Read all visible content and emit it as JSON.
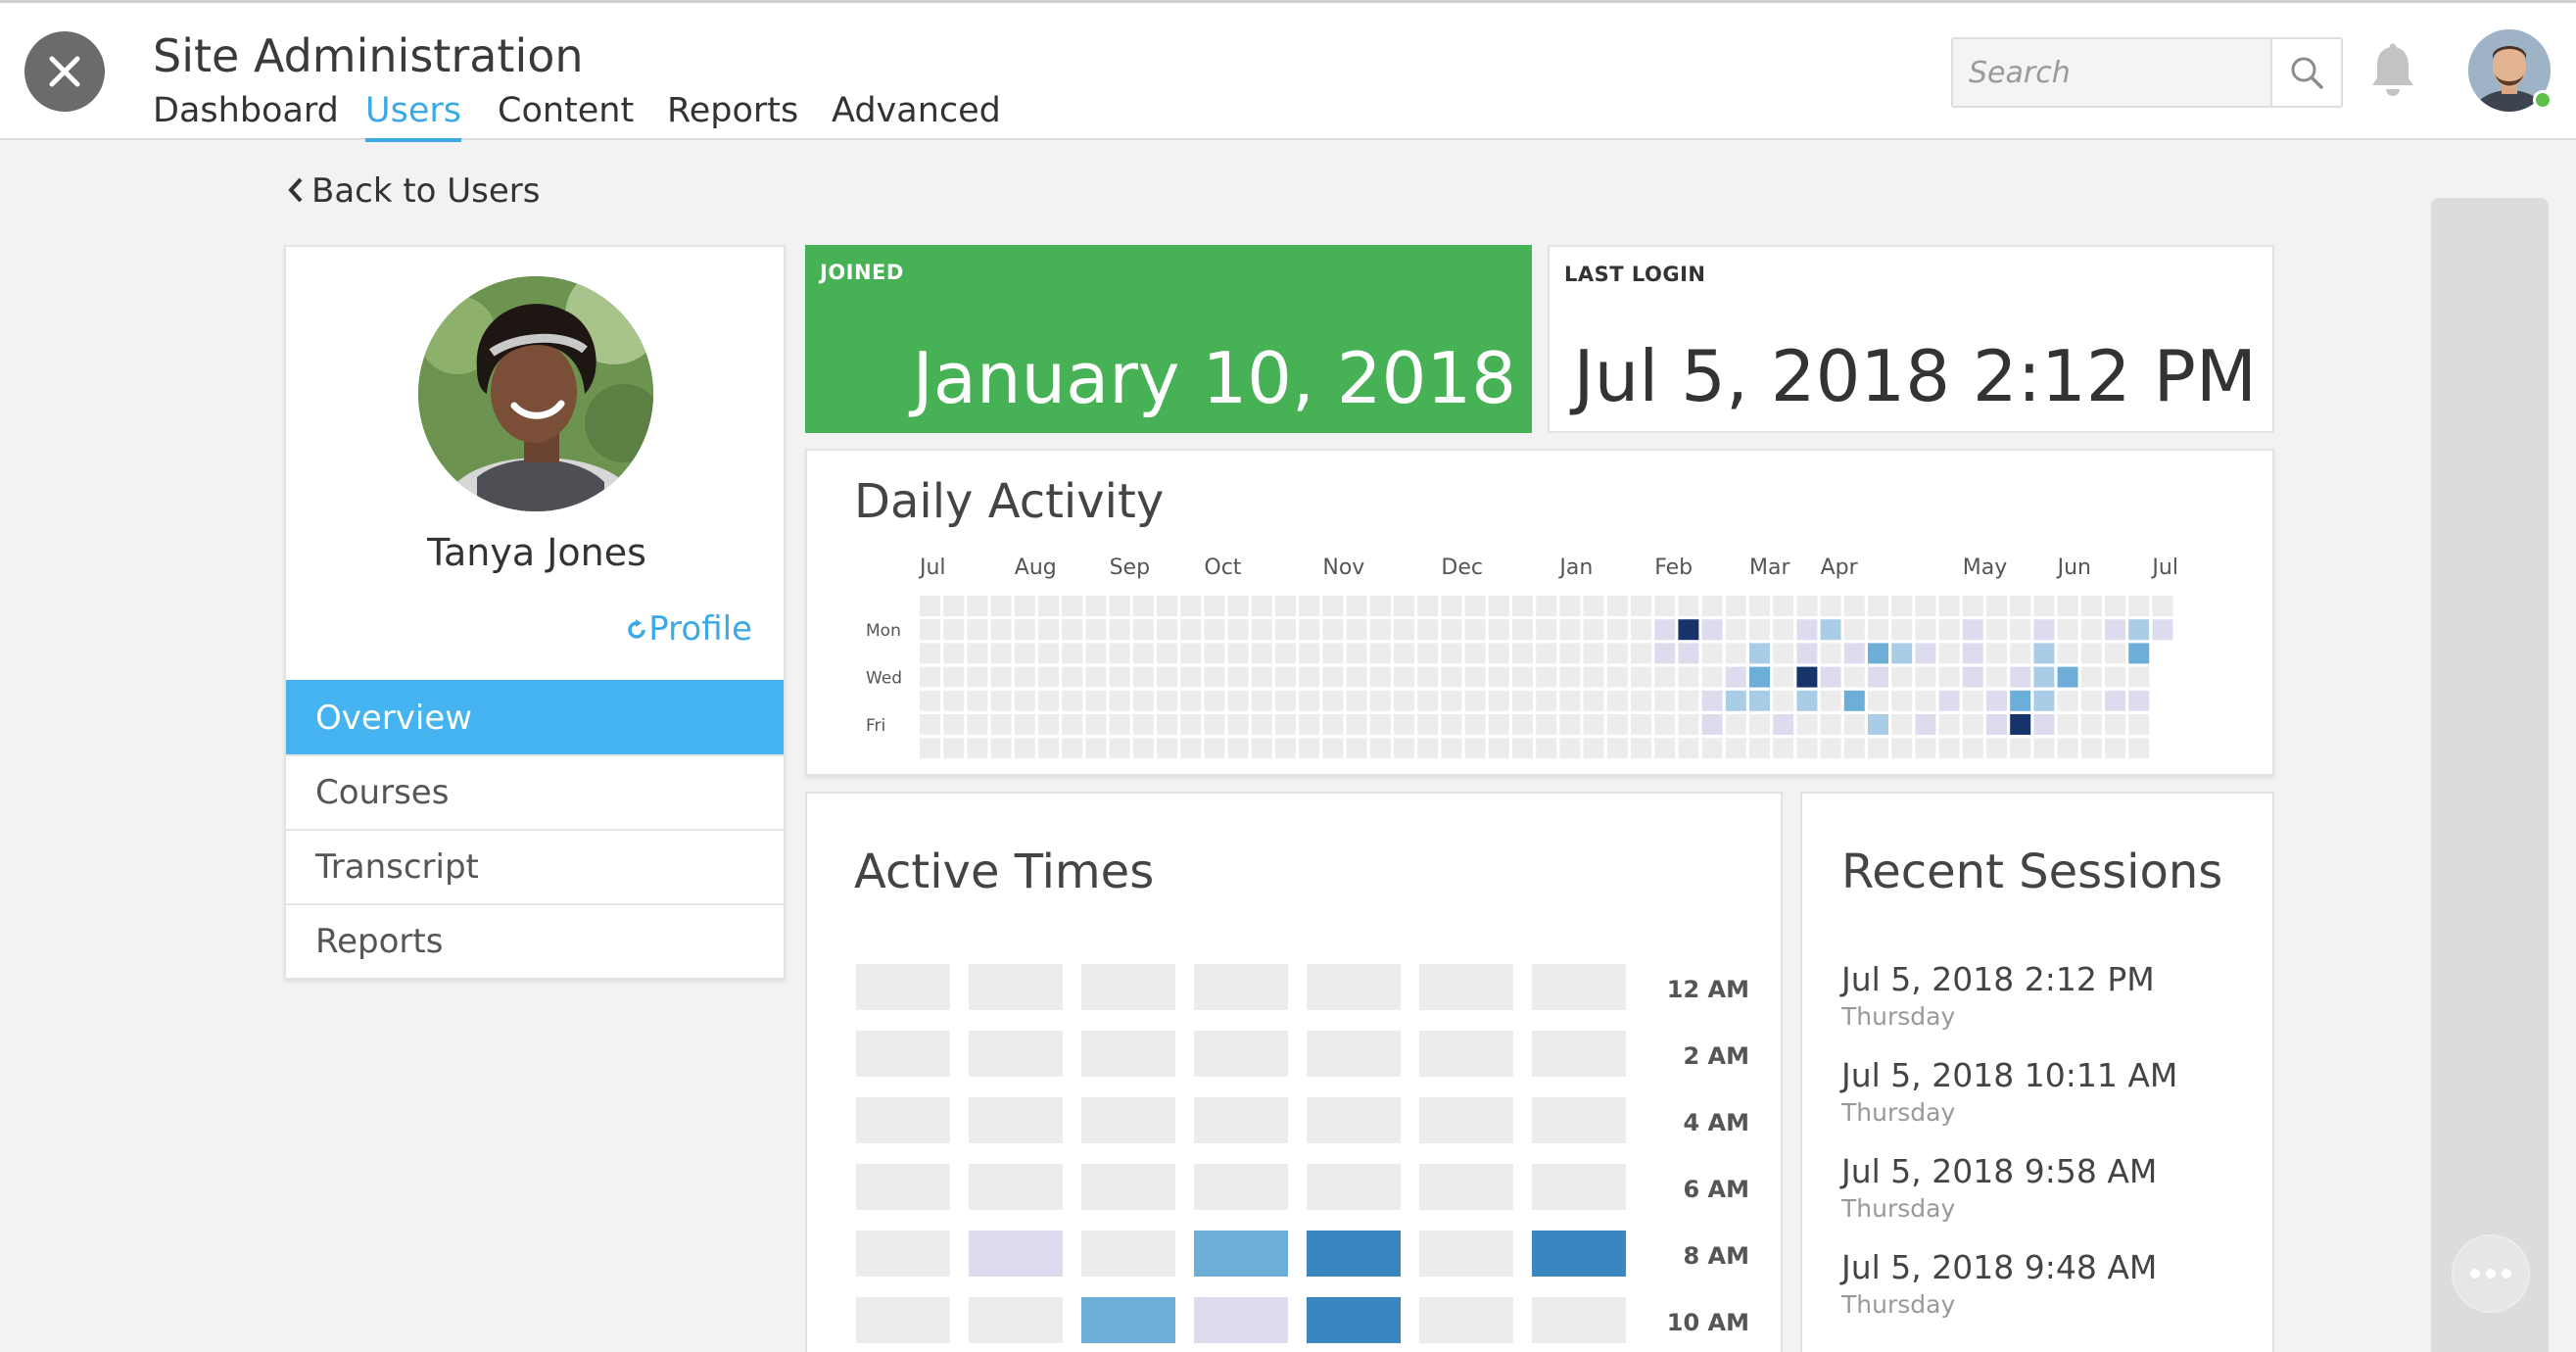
{
  "header": {
    "title": "Site Administration",
    "close_icon": "close-icon",
    "nav": [
      {
        "label": "Dashboard",
        "active": false
      },
      {
        "label": "Users",
        "active": true
      },
      {
        "label": "Content",
        "active": false
      },
      {
        "label": "Reports",
        "active": false
      },
      {
        "label": "Advanced",
        "active": false
      }
    ],
    "search": {
      "placeholder": "Search",
      "icon": "search-icon"
    },
    "bell_icon": "bell-icon",
    "accent": "#3aa9e6"
  },
  "back_link": {
    "label": "Back to Users",
    "icon": "chevron-left-icon"
  },
  "profile": {
    "name": "Tanya Jones",
    "link_label": "Profile",
    "link_icon": "refresh-icon",
    "menu": [
      {
        "label": "Overview",
        "active": true
      },
      {
        "label": "Courses",
        "active": false
      },
      {
        "label": "Transcript",
        "active": false
      },
      {
        "label": "Reports",
        "active": false
      }
    ]
  },
  "joined": {
    "label": "JOINED",
    "value": "January 10, 2018",
    "color": "#47b155"
  },
  "last_login": {
    "label": "LAST LOGIN",
    "value": "Jul 5, 2018 2:12 PM"
  },
  "daily_activity": {
    "title": "Daily Activity",
    "months": [
      {
        "label": "Jul",
        "week": 0
      },
      {
        "label": "Aug",
        "week": 4
      },
      {
        "label": "Sep",
        "week": 8
      },
      {
        "label": "Oct",
        "week": 12
      },
      {
        "label": "Nov",
        "week": 17
      },
      {
        "label": "Dec",
        "week": 22
      },
      {
        "label": "Jan",
        "week": 27
      },
      {
        "label": "Feb",
        "week": 31
      },
      {
        "label": "Mar",
        "week": 35
      },
      {
        "label": "Apr",
        "week": 38
      },
      {
        "label": "May",
        "week": 44
      },
      {
        "label": "Jun",
        "week": 48
      },
      {
        "label": "Jul",
        "week": 52
      }
    ],
    "day_labels": [
      {
        "label": "Mon",
        "row": 1
      },
      {
        "label": "Wed",
        "row": 3
      },
      {
        "label": "Fri",
        "row": 5
      }
    ],
    "weeks": 53,
    "last_week_rows": 2,
    "palette": [
      "#ececec",
      "#dddcef",
      "#a9cde6",
      "#6caed8",
      "#3a86c0",
      "#16336a"
    ],
    "active_cells": [
      [
        31,
        1,
        1
      ],
      [
        32,
        1,
        5
      ],
      [
        33,
        1,
        1
      ],
      [
        37,
        1,
        1
      ],
      [
        38,
        1,
        2
      ],
      [
        44,
        1,
        1
      ],
      [
        47,
        1,
        1
      ],
      [
        50,
        1,
        1
      ],
      [
        51,
        1,
        2
      ],
      [
        52,
        1,
        1
      ],
      [
        31,
        2,
        1
      ],
      [
        32,
        2,
        1
      ],
      [
        35,
        2,
        2
      ],
      [
        37,
        2,
        1
      ],
      [
        39,
        2,
        1
      ],
      [
        40,
        2,
        3
      ],
      [
        41,
        2,
        2
      ],
      [
        42,
        2,
        1
      ],
      [
        44,
        2,
        1
      ],
      [
        47,
        2,
        2
      ],
      [
        51,
        2,
        3
      ],
      [
        34,
        3,
        1
      ],
      [
        35,
        3,
        3
      ],
      [
        37,
        3,
        5
      ],
      [
        38,
        3,
        1
      ],
      [
        40,
        3,
        1
      ],
      [
        44,
        3,
        1
      ],
      [
        46,
        3,
        1
      ],
      [
        47,
        3,
        2
      ],
      [
        48,
        3,
        3
      ],
      [
        33,
        4,
        1
      ],
      [
        34,
        4,
        2
      ],
      [
        35,
        4,
        2
      ],
      [
        37,
        4,
        2
      ],
      [
        39,
        4,
        3
      ],
      [
        43,
        4,
        1
      ],
      [
        45,
        4,
        1
      ],
      [
        46,
        4,
        3
      ],
      [
        47,
        4,
        2
      ],
      [
        50,
        4,
        1
      ],
      [
        51,
        4,
        1
      ],
      [
        52,
        4,
        2
      ],
      [
        33,
        5,
        1
      ],
      [
        36,
        5,
        1
      ],
      [
        40,
        5,
        2
      ],
      [
        42,
        5,
        1
      ],
      [
        45,
        5,
        1
      ],
      [
        46,
        5,
        5
      ],
      [
        47,
        5,
        1
      ]
    ]
  },
  "active_times": {
    "title": "Active Times",
    "hours": [
      "12 AM",
      "2 AM",
      "4 AM",
      "6 AM",
      "8 AM",
      "10 AM"
    ],
    "columns": 7,
    "palette": [
      "#ececec",
      "#dddcef",
      "#6caed8",
      "#3a86c0"
    ],
    "levels": [
      [
        0,
        0,
        0,
        0,
        0,
        0,
        0
      ],
      [
        0,
        0,
        0,
        0,
        0,
        0,
        0
      ],
      [
        0,
        0,
        0,
        0,
        0,
        0,
        0
      ],
      [
        0,
        0,
        0,
        0,
        0,
        0,
        0
      ],
      [
        0,
        1,
        0,
        2,
        3,
        0,
        3
      ],
      [
        0,
        0,
        2,
        1,
        3,
        0,
        0
      ]
    ]
  },
  "recent_sessions": {
    "title": "Recent Sessions",
    "items": [
      {
        "time": "Jul 5, 2018 2:12 PM",
        "day": "Thursday"
      },
      {
        "time": "Jul 5, 2018 10:11 AM",
        "day": "Thursday"
      },
      {
        "time": "Jul 5, 2018 9:58 AM",
        "day": "Thursday"
      },
      {
        "time": "Jul 5, 2018 9:48 AM",
        "day": "Thursday"
      }
    ]
  },
  "chat_icon": "more-dots-icon"
}
